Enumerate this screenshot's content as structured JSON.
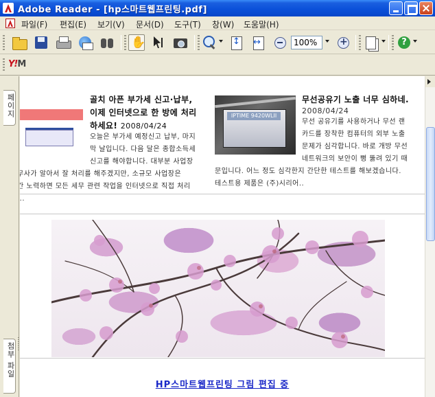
{
  "window": {
    "title": "Adobe Reader - [hp스마트웹프린팅.pdf]"
  },
  "menu": [
    "파일(F)",
    "편집(E)",
    "보기(V)",
    "문서(D)",
    "도구(T)",
    "창(W)",
    "도움말(H)"
  ],
  "toolbar": {
    "zoom_value": "100%"
  },
  "nav_tabs": {
    "pages": "페이지",
    "attachments": "첨부 파일"
  },
  "articles": [
    {
      "title_line1": "골치 아픈 부가세 신고·납부,",
      "title_line2": "이제 인터넷으로 한 방에 처리",
      "title_line3": "하세요!",
      "date": "2008/04/24",
      "body": [
        "오늘은 부가세 예정신고 납부, 마지",
        "막 날입니다. 다음 달은 종합소득세",
        "신고를 해야합니다. 대부분 사업장",
        "무사가 알아서 잘 처리를 해주겠지만, 소규모 사업장은",
        "간 노력하면 모든 세무 관련 작업을 인터넷으로 직접 처리",
        "..."
      ]
    },
    {
      "title": "무선공유기 노출 너무 심하네.",
      "date": "2008/04/24",
      "body": [
        "무선 공유기를 사용하거나 무선 랜",
        "카드를 장착한 컴퓨터의 외부 노출",
        "문제가 심각합니다. 바로 개방 무선",
        "네트워크의 보안이 뻥 뚫려 있기 때",
        "문입니다. 어느 정도 심각한지 간단한 테스트를 해보겠습니다.",
        "테스트용 제품은 (주)시리어.."
      ],
      "thumbnail_label": "IPTIME 9420WLII"
    }
  ],
  "caption": "HP스마트웹프린팅 그림 편집 중",
  "colors": {
    "title_bar": "#0a4fd8",
    "caption_link": "#1a28c8",
    "blossom": "#d8a8d4"
  }
}
